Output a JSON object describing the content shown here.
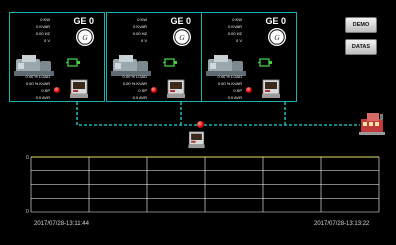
{
  "panels": [
    {
      "readings_top": [
        "0 KW",
        "0 KVAR",
        "0.00 HZ",
        "0 V"
      ],
      "ge_label": "GE 0",
      "readings_bottom": [
        "0.00 % LOAD",
        "0.00 % KVAR",
        "0 SP",
        "0.0 AVR"
      ]
    },
    {
      "readings_top": [
        "0 KW",
        "0 KVAR",
        "0.00 HZ",
        "0 V"
      ],
      "ge_label": "GE 0",
      "readings_bottom": [
        "0.00 % LOAD",
        "0.00 % KVAR",
        "0 SP",
        "0.0 AVR"
      ]
    },
    {
      "readings_top": [
        "0 KW",
        "0 KVAR",
        "0.00 HZ",
        "0 V"
      ],
      "ge_label": "GE 0",
      "readings_bottom": [
        "0.00 % LOAD",
        "0.00 % KVAR",
        "0 SP",
        "0.0 AVR"
      ]
    }
  ],
  "buttons": {
    "demo": "DEMO",
    "datas": "DATAS"
  },
  "chart": {
    "y_tick_top": "0",
    "y_tick_bottom": "0",
    "start_time": "2017/07/28-13:11:44",
    "end_time": "2017/07/28-13:13:22"
  },
  "colors": {
    "panel_border": "#16b3b3",
    "bus_line": "#16b3b3",
    "grid": "#ffffff",
    "trace": "#e8e26a",
    "status_dot": "#e00000",
    "generator_icon": "#40d040"
  },
  "icons": [
    "engine-generator-icon",
    "ge-logo-icon",
    "generator-icon",
    "controller-icon",
    "status-dot-icon",
    "building-icon"
  ]
}
